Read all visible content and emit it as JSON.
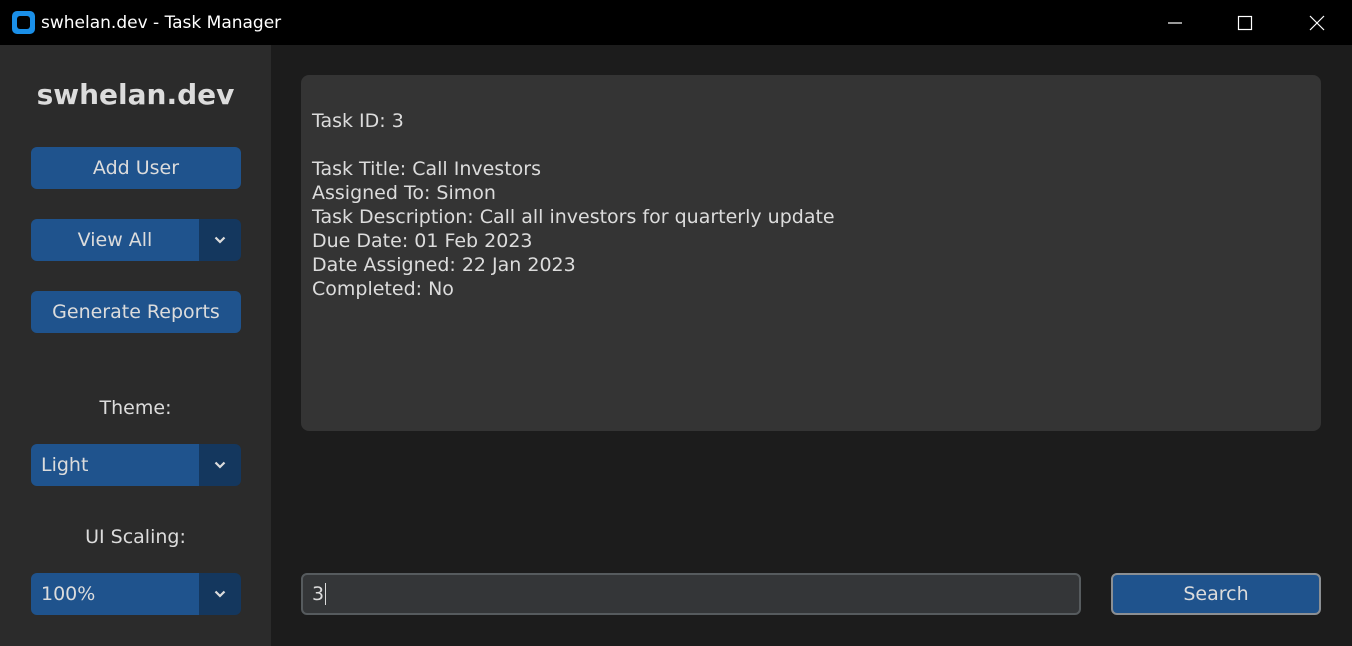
{
  "window": {
    "title": "swhelan.dev - Task Manager",
    "controls": [
      "minimize",
      "maximize",
      "close"
    ]
  },
  "sidebar": {
    "brand": "swhelan.dev",
    "add_user": "Add User",
    "view_all": "View All",
    "generate_reports": "Generate Reports",
    "theme_label": "Theme:",
    "theme_value": "Light",
    "scaling_label": "UI Scaling:",
    "scaling_value": "100%"
  },
  "task": {
    "id_line": "Task ID: 3",
    "title_line": "Task Title: Call Investors",
    "assigned_line": "Assigned To: Simon",
    "description_line": "Task Description: Call all investors for quarterly update",
    "due_line": "Due Date: 01 Feb 2023",
    "assigned_date_line": "Date Assigned: 22 Jan 2023",
    "completed_line": "Completed: No"
  },
  "search": {
    "value": "3",
    "button": "Search"
  },
  "colors": {
    "accent": "#1f538d",
    "accent_dark": "#14375e",
    "sidebar_bg": "#2b2b2b",
    "main_bg": "#1c1c1c",
    "textbox_bg": "#343434"
  }
}
